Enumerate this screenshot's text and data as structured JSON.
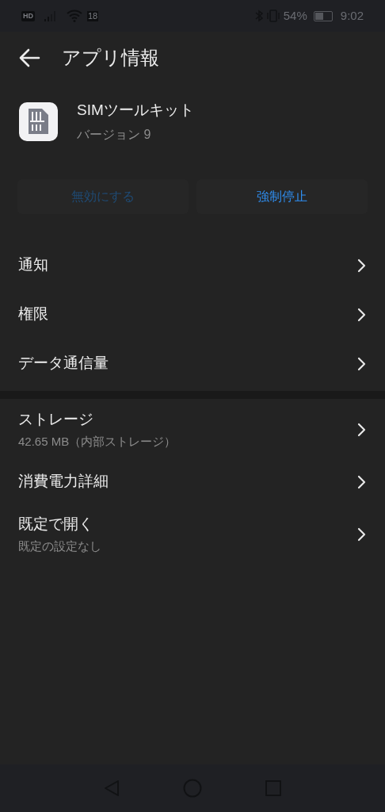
{
  "status_bar": {
    "hd": "HD",
    "sim_badge": "18",
    "battery_percent": "54%",
    "time": "9:02"
  },
  "header": {
    "title": "アプリ情報"
  },
  "app": {
    "name": "SIMツールキット",
    "version": "バージョン 9"
  },
  "buttons": [
    {
      "label": "無効にする",
      "disabled": true
    },
    {
      "label": "強制停止",
      "disabled": false
    }
  ],
  "sections": [
    {
      "items": [
        {
          "title": "通知"
        },
        {
          "title": "権限"
        },
        {
          "title": "データ通信量"
        }
      ]
    },
    {
      "items": [
        {
          "title": "ストレージ",
          "subtitle": "42.65 MB（内部ストレージ）"
        },
        {
          "title": "消費電力詳細"
        },
        {
          "title": "既定で開く",
          "subtitle": "既定の設定なし"
        }
      ]
    }
  ]
}
